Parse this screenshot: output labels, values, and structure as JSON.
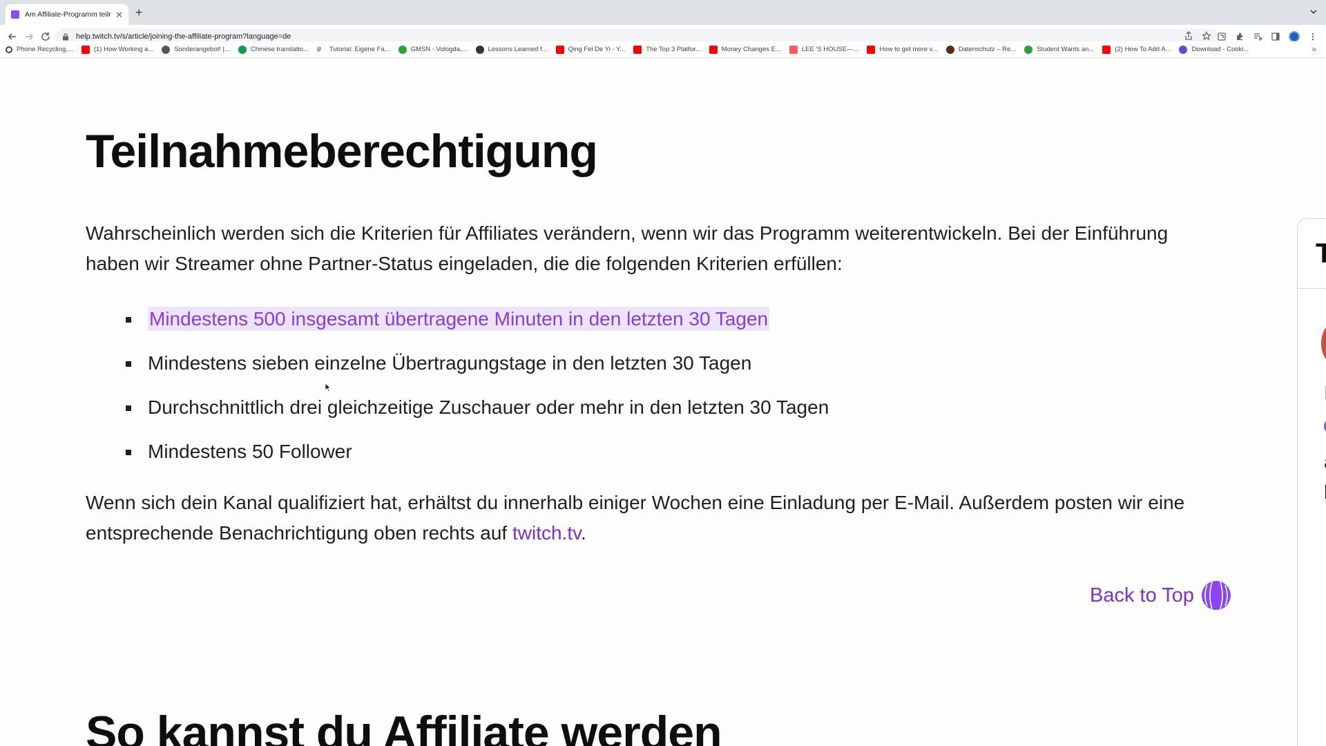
{
  "browser": {
    "tab": {
      "title": "Am Affiliate-Programm teilneh",
      "favicon": "twitch-icon"
    },
    "url": "help.twitch.tv/s/article/joining-the-affiliate-program?language=de",
    "bookmarks": [
      {
        "label": "Phone Recycling,...",
        "icon": "search-icon",
        "color": "#444444"
      },
      {
        "label": "(1) How Working a...",
        "icon": "youtube-icon",
        "color": "#ff0000"
      },
      {
        "label": "Sonderangebot! |...",
        "icon": "site-icon",
        "color": "#555555"
      },
      {
        "label": "Chinese translatio...",
        "icon": "site-icon",
        "color": "#0f9d58"
      },
      {
        "label": "Tutorial: Eigene Fa...",
        "icon": "hash-icon",
        "color": "#333333"
      },
      {
        "label": "GMSN - Vologda,...",
        "icon": "site-icon",
        "color": "#2e9e3a"
      },
      {
        "label": "Lessons Learned f...",
        "icon": "site-icon",
        "color": "#333333"
      },
      {
        "label": "Qing Fei De Yi - Y...",
        "icon": "youtube-icon",
        "color": "#ff0000"
      },
      {
        "label": "The Top 3 Platfor...",
        "icon": "youtube-icon",
        "color": "#ff0000"
      },
      {
        "label": "Money Changes E...",
        "icon": "youtube-icon",
        "color": "#ff0000"
      },
      {
        "label": "LEE 'S HOUSE—...",
        "icon": "airbnb-icon",
        "color": "#ff5a5f"
      },
      {
        "label": "How to get more v...",
        "icon": "youtube-icon",
        "color": "#ff0000"
      },
      {
        "label": "Datenschutz – Re...",
        "icon": "site-icon",
        "color": "#5a2a1a"
      },
      {
        "label": "Student Wants an...",
        "icon": "site-icon",
        "color": "#2e9e3a"
      },
      {
        "label": "(2) How To Add A...",
        "icon": "youtube-icon",
        "color": "#ff0000"
      },
      {
        "label": "Download - Cooki...",
        "icon": "site-icon",
        "color": "#5b4fd1"
      }
    ]
  },
  "article": {
    "heading1": "Teilnahmeberechtigung",
    "intro": "Wahrscheinlich werden sich die Kriterien für Affiliates verändern, wenn wir das Programm weiterentwickeln. Bei der Einführung haben wir Streamer ohne Partner-Status eingeladen, die die folgenden Kriterien erfüllen:",
    "criteria": [
      "Mindestens 500 insgesamt übertragene Minuten in den letzten 30 Tagen",
      "Mindestens sieben einzelne Übertragungstage in den letzten 30 Tagen",
      "Durchschnittlich drei gleichzeitige Zuschauer oder mehr in den letzten 30 Tagen",
      "Mindestens 50 Follower"
    ],
    "outro_text": "Wenn sich dein Kanal qualifiziert hat, erhältst du innerhalb einiger Wochen eine Einladung per E-Mail. Außerdem posten wir eine entsprechende Benachrichtigung oben rechts auf ",
    "outro_link": "twitch.tv",
    "outro_end": ".",
    "back_to_top": "Back to Top",
    "heading2": "So kannst du Affiliate werden"
  },
  "side_panel": {
    "letter": "T",
    "fragments": [
      "I",
      "a",
      "k"
    ]
  },
  "colors": {
    "accent": "#7d2fd0",
    "highlight_bg": "#ece4fa",
    "text": "#1f1f23"
  }
}
